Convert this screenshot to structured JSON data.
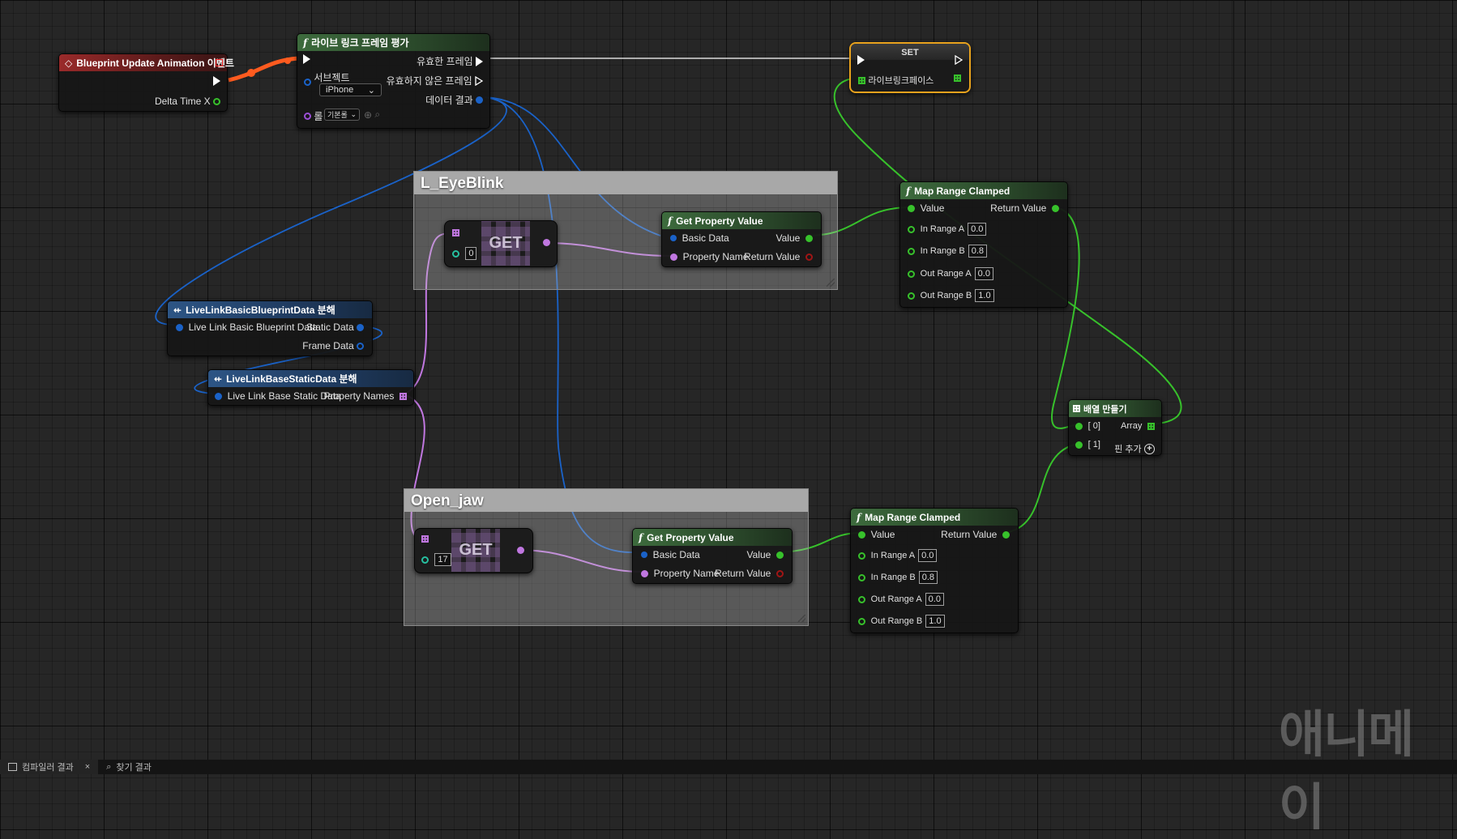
{
  "nodes": {
    "event": {
      "title": "Blueprint Update Animation 이벤트",
      "delta_time": "Delta Time X"
    },
    "evaluate": {
      "title": "라이브 링크 프레임 평가",
      "valid_frame": "유효한 프레임",
      "invalid_frame": "유효하지 않은 프레임",
      "subject_label": "서브젝트",
      "subject_value": "iPhone",
      "data_result": "데이터 결과",
      "role_label": "롤",
      "role_value": "기본롤"
    },
    "set": {
      "title": "SET",
      "variable": "라이브링크페이스"
    },
    "break_blueprint": {
      "title": "LiveLinkBasicBlueprintData 분해",
      "input": "Live Link Basic Blueprint Data",
      "static_data": "Static Data",
      "frame_data": "Frame Data"
    },
    "break_static": {
      "title": "LiveLinkBaseStaticData 분해",
      "input": "Live Link Base Static Data",
      "property_names": "Property Names"
    },
    "comment_eye": {
      "title": "L_EyeBlink"
    },
    "comment_jaw": {
      "title": "Open_jaw"
    },
    "get_eye": {
      "label": "GET",
      "index": "0"
    },
    "get_jaw": {
      "label": "GET",
      "index": "17"
    },
    "gpv_eye": {
      "title": "Get Property Value",
      "basic_data": "Basic Data",
      "property_name": "Property Name",
      "value": "Value",
      "return_value": "Return Value"
    },
    "gpv_jaw": {
      "title": "Get Property Value",
      "basic_data": "Basic Data",
      "property_name": "Property Name",
      "value": "Value",
      "return_value": "Return Value"
    },
    "map_eye": {
      "title": "Map Range Clamped",
      "value": "Value",
      "return_value": "Return Value",
      "in_range_a": "In Range A",
      "in_range_a_val": "0.0",
      "in_range_b": "In Range B",
      "in_range_b_val": "0.8",
      "out_range_a": "Out Range A",
      "out_range_a_val": "0.0",
      "out_range_b": "Out Range B",
      "out_range_b_val": "1.0"
    },
    "map_jaw": {
      "title": "Map Range Clamped",
      "value": "Value",
      "return_value": "Return Value",
      "in_range_a": "In Range A",
      "in_range_a_val": "0.0",
      "in_range_b": "In Range B",
      "in_range_b_val": "0.8",
      "out_range_a": "Out Range A",
      "out_range_a_val": "0.0",
      "out_range_b": "Out Range B",
      "out_range_b_val": "1.0"
    },
    "make_array": {
      "title": "배열 만들기",
      "item0": "[ 0]",
      "item1": "[ 1]",
      "array": "Array",
      "add_pin": "핀 추가"
    }
  },
  "bottom": {
    "tab1": "컴파일러 결과",
    "tab2": "찾기 결과"
  },
  "watermark": "애니메이",
  "colors": {
    "exec": "#ffffff",
    "float": "#37c12b",
    "struct": "#1a62c8",
    "name": "#c077e0",
    "event_header": "#9a2a2a",
    "function_header": "#3d6b3d",
    "break_header": "#2d5585",
    "set_highlight": "#e8a21d"
  }
}
